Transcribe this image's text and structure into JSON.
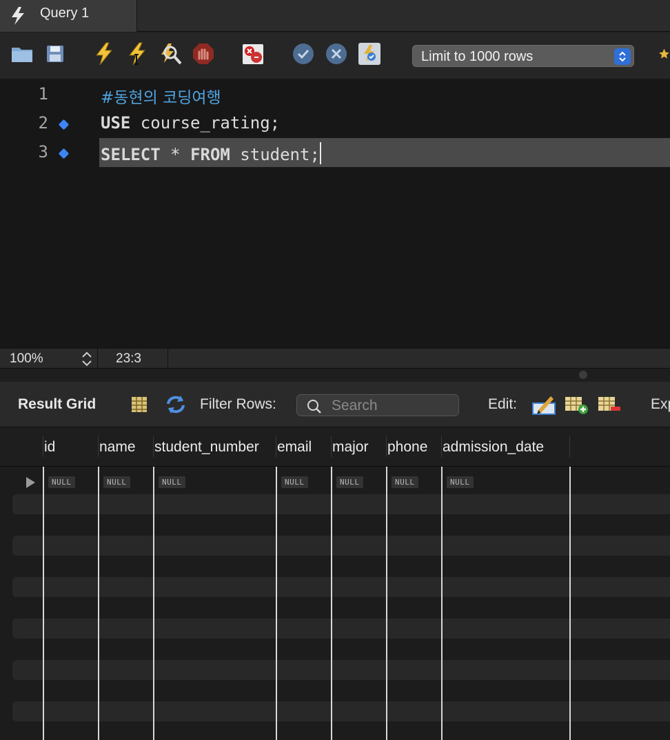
{
  "tab": {
    "title": "Query 1",
    "icon": "lightning-icon"
  },
  "toolbar": {
    "icons": [
      "open-folder-icon",
      "save-icon",
      "execute-icon",
      "execute-current-icon",
      "explain-icon",
      "stop-icon",
      "toggle-error-stop-icon",
      "commit-icon",
      "rollback-icon",
      "autocommit-icon",
      "star-icon"
    ],
    "limit_select": "Limit to 1000 rows"
  },
  "editor": {
    "lines": [
      {
        "number": "1",
        "comment": "#동현의 코딩여행"
      },
      {
        "number": "2",
        "keyword": "USE",
        "rest": " course_rating;"
      },
      {
        "number": "3",
        "keyword1": "SELECT",
        "op": " * ",
        "keyword2": "FROM",
        "rest": " student;"
      }
    ],
    "accent_color": "#4fa3e0"
  },
  "status": {
    "zoom": "100%",
    "position": "23:3"
  },
  "result": {
    "title": "Result Grid",
    "filter_label": "Filter Rows:",
    "search_placeholder": "Search",
    "edit_label": "Edit:",
    "export_label": "Exp"
  },
  "grid": {
    "columns": [
      "id",
      "name",
      "student_number",
      "email",
      "major",
      "phone",
      "admission_date"
    ],
    "row": [
      "NULL",
      "NULL",
      "NULL",
      "NULL",
      "NULL",
      "NULL",
      "NULL"
    ]
  }
}
